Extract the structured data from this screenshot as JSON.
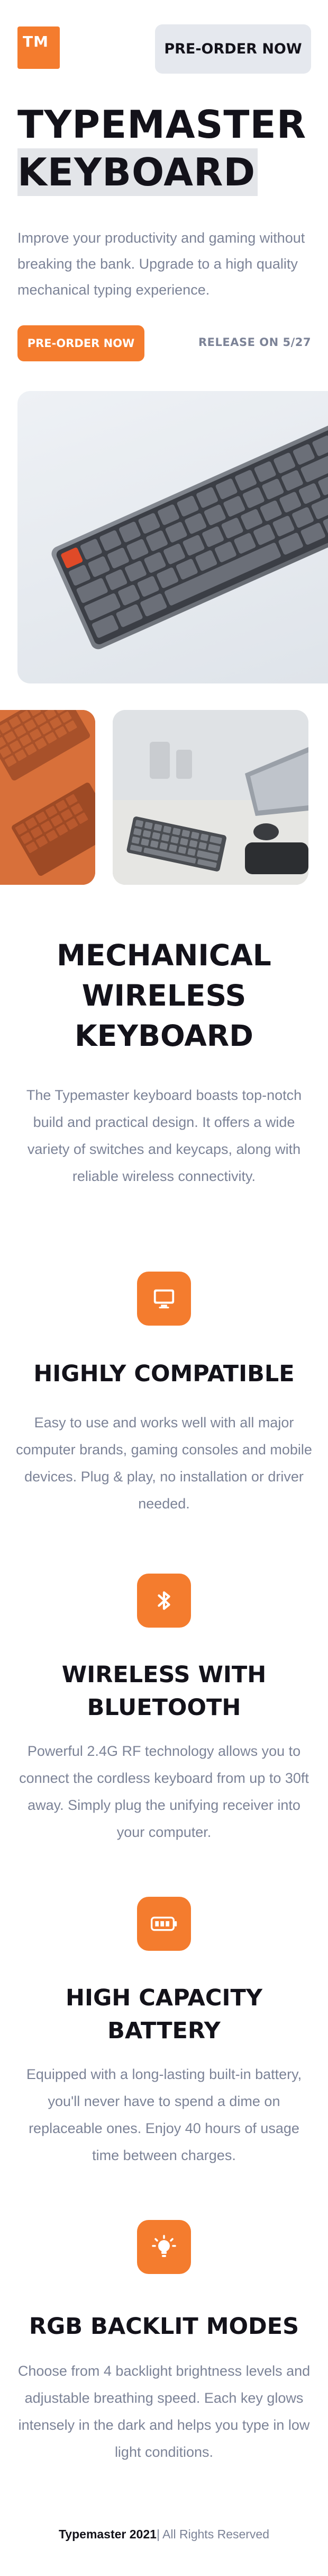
{
  "header": {
    "logo_text": "TM",
    "preorder_label": "PRE-ORDER NOW"
  },
  "hero": {
    "title_line1": "TYPEMASTER",
    "title_line2": "KEYBOARD",
    "description": "Improve your productivity and gaming without breaking the bank. Upgrade to a high quality mechanical typing experience.",
    "preorder_label": "PRE-ORDER NOW",
    "release_text": "RELEASE ON 5/27"
  },
  "intro": {
    "title": "MECHANICAL WIRELESS KEYBOARD",
    "description": "The Typemaster keyboard boasts top-notch build and practical design. It offers a wide variety of switches and keycaps, along with reliable wireless connectivity."
  },
  "features": [
    {
      "icon": "monitor-icon",
      "title": "HIGHLY COMPATIBLE",
      "description": "Easy to use and works well with all major computer brands, gaming consoles and mobile devices. Plug & play, no installation or driver needed."
    },
    {
      "icon": "bluetooth-icon",
      "title": "WIRELESS WITH BLUETOOTH",
      "description": "Powerful 2.4G RF technology allows you to connect the cordless keyboard from up to 30ft away. Simply plug the unifying receiver into your computer."
    },
    {
      "icon": "battery-icon",
      "title": "HIGH CAPACITY BATTERY",
      "description": "Equipped with a long-lasting built-in battery, you'll never have to spend a dime on replaceable ones. Enjoy 40 hours of usage time between charges."
    },
    {
      "icon": "lightbulb-icon",
      "title": "RGB BACKLIT MODES",
      "description": "Choose from 4 backlight brightness levels and adjustable breathing speed. Each key glows intensely in the dark and helps you type in low light conditions."
    }
  ],
  "footer": {
    "brand": "Typemaster 2021",
    "separator": "|",
    "rights": "All Rights Reserved"
  },
  "colors": {
    "accent": "#f47c2e",
    "text": "#13121a",
    "muted": "#7c8397",
    "button_bg": "#e5e8ee"
  }
}
